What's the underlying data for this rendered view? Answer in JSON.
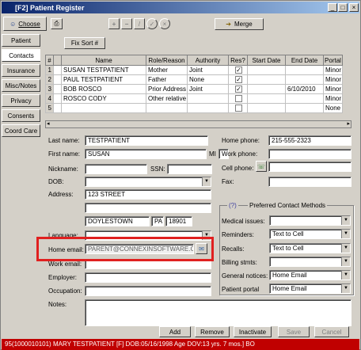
{
  "window": {
    "title": "[F2] Patient Register",
    "controls": [
      "_",
      "□",
      "×"
    ]
  },
  "toolbar": {
    "choose": "Choose",
    "merge": "Merge",
    "fix_sort": "Fix Sort #"
  },
  "tabs": [
    "Patient",
    "Contacts",
    "Insurance",
    "Misc/Notes",
    "Privacy",
    "Consents",
    "Coord Care"
  ],
  "grid": {
    "headers": [
      "#",
      "",
      "Name",
      "Role/Reason",
      "Authority",
      "Res?",
      "Start Date",
      "End Date",
      "Portal"
    ],
    "rows": [
      {
        "num": "1",
        "name": "SUSAN  TESTPATIENT",
        "role": "Mother",
        "auth": "Joint",
        "res": true,
        "start": "",
        "end": "",
        "portal": "Minor"
      },
      {
        "num": "2",
        "name": "PAUL  TESTPATIENT",
        "role": "Father",
        "auth": "None",
        "res": true,
        "start": "",
        "end": "",
        "portal": "Minor"
      },
      {
        "num": "3",
        "name": "BOB  ROSCO",
        "role": "Prior Address",
        "auth": "Joint",
        "res": true,
        "start": "",
        "end": "6/10/2010",
        "portal": "Minor"
      },
      {
        "num": "4",
        "name": "ROSCO  CODY",
        "role": "Other relative",
        "auth": "",
        "res": false,
        "start": "",
        "end": "",
        "portal": "Minor"
      },
      {
        "num": "5",
        "name": "",
        "role": "",
        "auth": "",
        "res": false,
        "start": "",
        "end": "",
        "portal": "None"
      }
    ]
  },
  "form": {
    "last_name_label": "Last name:",
    "last_name": "TESTPATIENT",
    "first_name_label": "First name:",
    "first_name": "SUSAN",
    "mi_label": "MI",
    "nickname_label": "Nickname:",
    "ssn_label": "SSN:",
    "dob_label": "DOB:",
    "address_label": "Address:",
    "address1": "123 STREET",
    "city": "DOYLESTOWN",
    "state": "PA",
    "zip": "18901",
    "language_label": "Language:",
    "home_email_label": "Home email:",
    "home_email": "PARENT@CONNEXINSOFTWARE.COM",
    "work_email_label": "Work email:",
    "employer_label": "Employer:",
    "occupation_label": "Occupation:",
    "notes_label": "Notes:",
    "home_phone_label": "Home phone:",
    "home_phone": "215-555-2323",
    "work_phone_label": "Work phone:",
    "cell_phone_label": "Cell phone:",
    "fax_label": "Fax:"
  },
  "preferred": {
    "title": "Preferred Contact Methods",
    "medical_label": "Medical issues:",
    "medical": "",
    "reminders_label": "Reminders:",
    "reminders": "Text to Cell",
    "recalls_label": "Recalls:",
    "recalls": "Text to Cell",
    "billing_label": "Billing stmts:",
    "billing": "",
    "general_label": "General notices:",
    "general": "Home Email",
    "portal_label": "Patient portal",
    "portal": "Home Email"
  },
  "buttons": {
    "add": "Add",
    "remove": "Remove",
    "inactivate": "Inactivate",
    "save": "Save",
    "cancel": "Cancel"
  },
  "status": "95(1000010101) MARY TESTPATIENT [F] DOB:05/16/1998 Age DOV:13 yrs. 7 mos.] BO"
}
